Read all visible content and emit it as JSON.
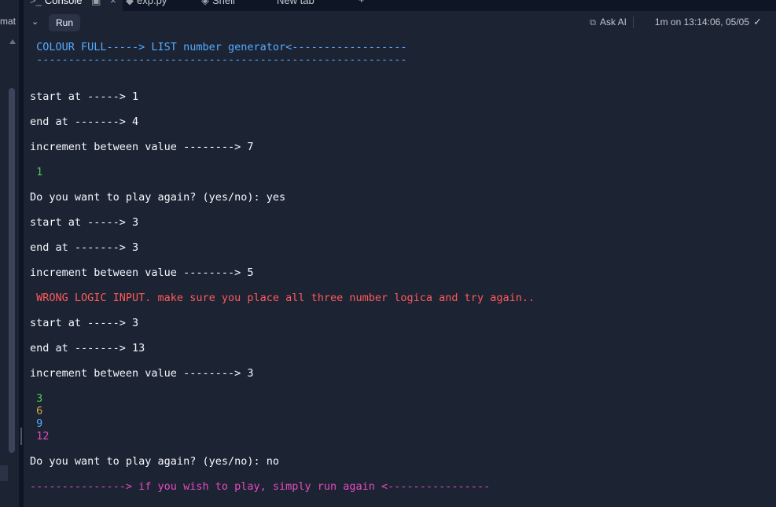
{
  "left_pane": {
    "label": "mat"
  },
  "tabs": [
    {
      "icon": ">_",
      "label": "Console",
      "extra": "▣",
      "close": "×",
      "active": true
    },
    {
      "icon": "◆",
      "label": "exp.py",
      "close": "",
      "active": false
    },
    {
      "icon": "◈",
      "label": "Shell",
      "close": "",
      "active": false
    },
    {
      "icon": "",
      "label": "New tab",
      "close": "",
      "active": false
    }
  ],
  "tab_add": "+",
  "toolbar": {
    "chevron": "⌄",
    "run_label": "Run",
    "ask_ai_icon": "⧉",
    "ask_ai_label": "Ask AI",
    "status_text": "1m on 13:14:06, 05/05",
    "check": "✓"
  },
  "console": {
    "header1": " COLOUR FULL-----> LIST number generator<------------------",
    "header2": " ----------------------------------------------------------",
    "lines": [
      "start at -----> 1",
      "end at -------> 4",
      "increment between value --------> 7",
      " 1",
      "Do you want to play again? (yes/no): yes",
      "start at -----> 3",
      "end at -------> 3",
      "increment between value --------> 5",
      " WRONG LOGIC INPUT. make sure you place all three number logica and try again..",
      "start at -----> 3",
      "end at -------> 13",
      "increment between value --------> 3",
      " 3",
      " 6",
      " 9",
      " 12",
      "Do you want to play again? (yes/no): no",
      "---------------> if you wish to play, simply run again <----------------"
    ]
  },
  "colors": {
    "background": "#1c2333",
    "header": "#57abff",
    "green": "#4fcc5e",
    "orange": "#d6a843",
    "blue": "#57abff",
    "red": "#ff5a5a",
    "pink": "#e64bbf"
  }
}
